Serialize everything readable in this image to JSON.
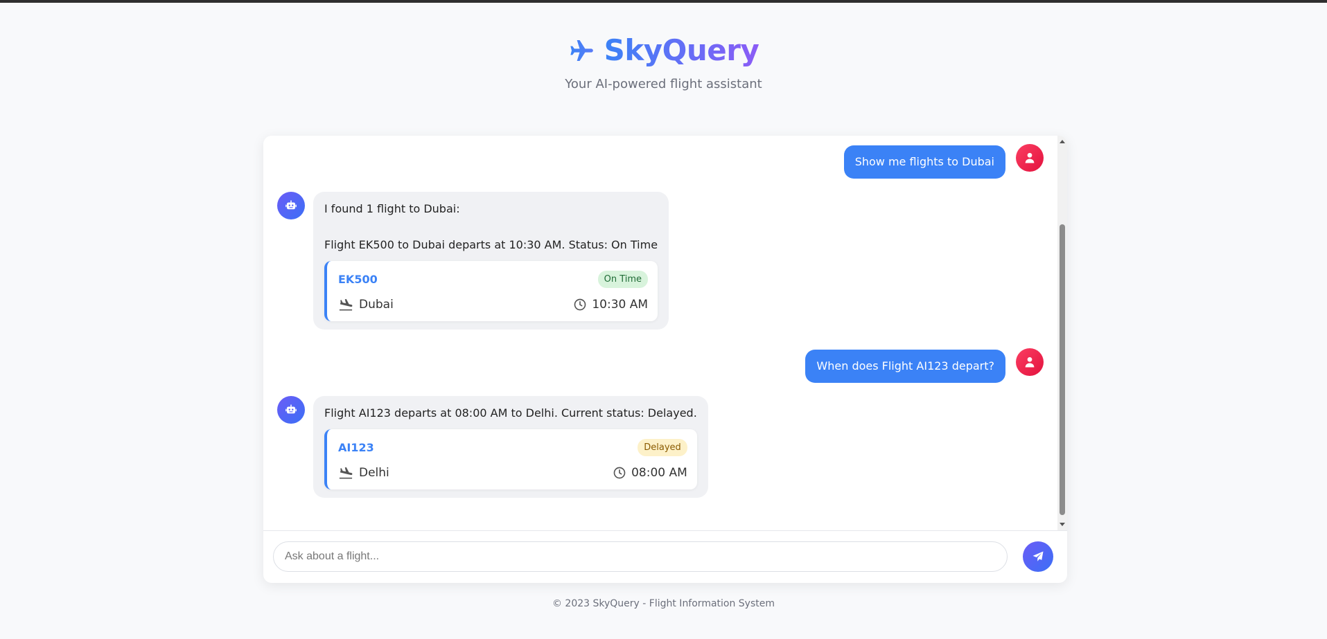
{
  "header": {
    "title": "SkyQuery",
    "subtitle": "Your AI-powered flight assistant",
    "logo_icon": "plane-icon"
  },
  "messages": [
    {
      "role": "user",
      "text": "Show me flights to Dubai"
    },
    {
      "role": "bot",
      "text": "I found 1 flight to Dubai:",
      "text2": "Flight EK500 to Dubai departs at 10:30 AM. Status: On Time",
      "flight": {
        "number": "EK500",
        "status": "On Time",
        "destination": "Dubai",
        "time": "10:30 AM"
      }
    },
    {
      "role": "user",
      "text": "When does Flight AI123 depart?"
    },
    {
      "role": "bot",
      "text": "Flight AI123 departs at 08:00 AM to Delhi. Current status: Delayed.",
      "flight": {
        "number": "AI123",
        "status": "Delayed",
        "destination": "Delhi",
        "time": "08:00 AM"
      }
    }
  ],
  "input": {
    "placeholder": "Ask about a flight...",
    "value": ""
  },
  "footer": {
    "text": "© 2023 SkyQuery - Flight Information System"
  },
  "colors": {
    "accent": "#3b82f6",
    "accent_purple": "#8b5cf6",
    "user_avatar": "#f2234f",
    "ontime_badge_bg": "#d8f3dc",
    "delayed_badge_bg": "#fdf1c9"
  }
}
